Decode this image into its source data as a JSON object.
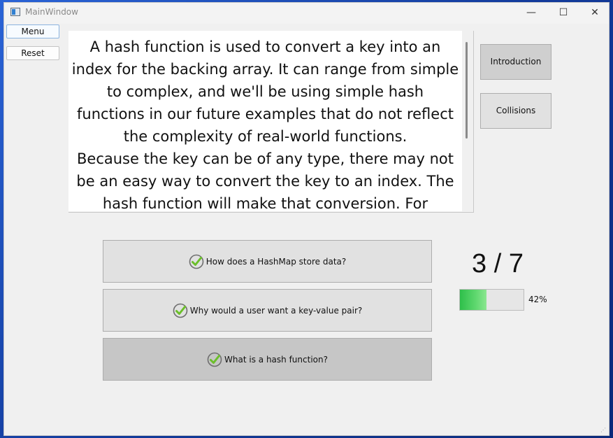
{
  "window": {
    "title": "MainWindow",
    "controls": {
      "minimize": "—",
      "maximize": "☐",
      "close": "✕"
    }
  },
  "sidebar": {
    "menu_label": "Menu",
    "reset_label": "Reset"
  },
  "content": {
    "paragraphs": [
      "A hash function is used to convert a key into an index for the backing array. It can range from simple to complex, and we'll be using simple hash functions in our future examples that do not reflect the complexity of real-world functions.",
      "Because the key can be of any type, there may not be an easy way to convert the key to an index. The hash function will make that conversion. For"
    ]
  },
  "topics": {
    "introduction_label": "Introduction",
    "collisions_label": "Collisions"
  },
  "questions": [
    {
      "label": "How does a HashMap store data?",
      "completed": true
    },
    {
      "label": "Why would a user want a key-value pair?",
      "completed": true
    },
    {
      "label": "What is a hash function?",
      "completed": true
    }
  ],
  "progress": {
    "count_text": "3 / 7",
    "percent_text": "42%",
    "fraction": 0.42,
    "fill_color": "#3ec957"
  },
  "colors": {
    "check_green": "#6bbf2a",
    "check_circle": "#6e6e6e"
  }
}
